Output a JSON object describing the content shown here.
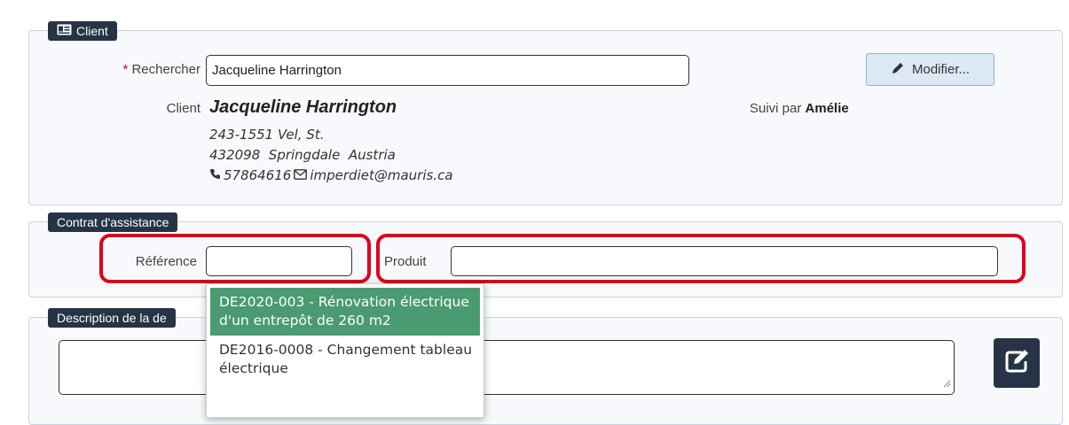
{
  "client": {
    "legend": "Client",
    "search_label": "Rechercher",
    "required_mark": "*",
    "search_value": "Jacqueline Harrington",
    "modify_label": "Modifier...",
    "client_label": "Client",
    "name": "Jacqueline Harrington",
    "address1": "243-1551 Vel, St.",
    "address2": "432098  Springdale  Austria",
    "phone": "57864616",
    "email": "imperdiet@mauris.ca",
    "followed_by_label": "Suivi par",
    "followed_by": "Amélie"
  },
  "contract": {
    "legend": "Contrat d'assistance",
    "reference_label": "Référence",
    "reference_value": "",
    "product_label": "Produit",
    "product_value": ""
  },
  "description": {
    "legend": "Description de la de",
    "value": ""
  },
  "dropdown": {
    "items": [
      "DE2020-003 - Rénovation électrique d'un entrepôt de 260 m2",
      "DE2016-0008 - Changement tableau électrique"
    ],
    "selected_index": 0,
    "selected_color": "#4a9a72"
  },
  "highlight_color": "#e0001a"
}
